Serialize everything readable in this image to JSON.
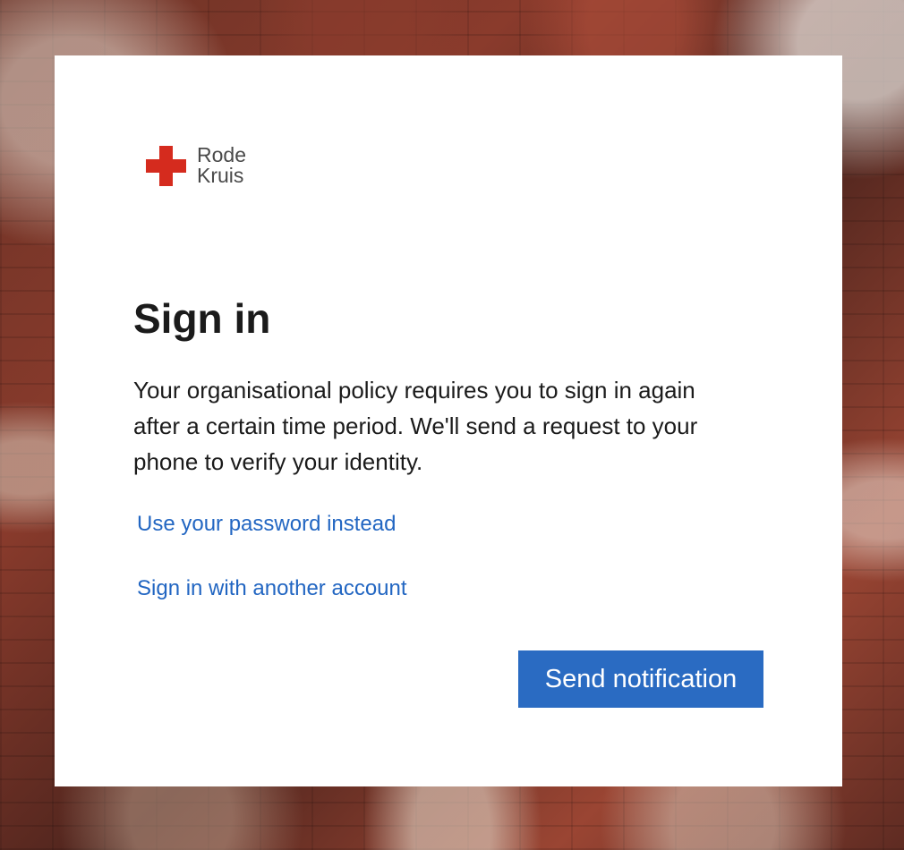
{
  "logo": {
    "line1": "Rode",
    "line2": "Kruis",
    "brand_color": "#d52b1e"
  },
  "signin": {
    "title": "Sign in",
    "description": "Your organisational policy requires you to sign in again after a certain time period. We'll send a request to your phone to verify your identity.",
    "use_password_link": "Use your password instead",
    "other_account_link": "Sign in with another account",
    "send_button": "Send notification"
  },
  "colors": {
    "link": "#2266c2",
    "button": "#2a6bc2"
  }
}
